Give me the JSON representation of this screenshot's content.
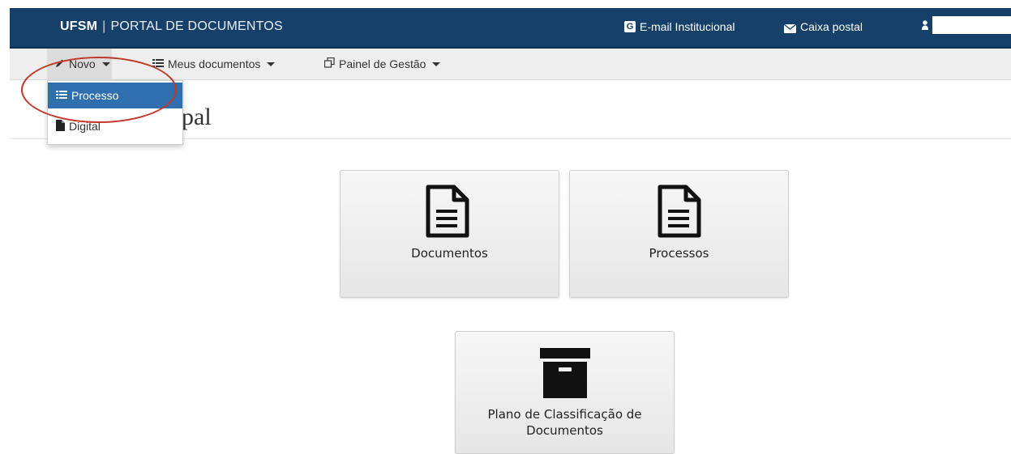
{
  "header": {
    "brand_strong": "UFSM",
    "brand_sep": "|",
    "brand_rest": "PORTAL DE DOCUMENTOS",
    "email_label": "E-mail Institucional",
    "email_icon": "G",
    "mail_label": "Caixa postal"
  },
  "nav": {
    "novo": "Novo",
    "meus_documentos": "Meus documentos",
    "painel": "Painel de Gestão"
  },
  "dropdown": {
    "items": [
      {
        "label": "Processo",
        "icon": "list-icon"
      },
      {
        "label": "Digital",
        "icon": "file-icon"
      }
    ]
  },
  "page": {
    "title_visible": "pal"
  },
  "tiles": [
    {
      "label": "Documentos",
      "icon": "document-icon"
    },
    {
      "label": "Processos",
      "icon": "document-icon"
    },
    {
      "label_line1": "Plano de Classificação de",
      "label_line2": "Documentos",
      "icon": "archive-box-icon"
    }
  ],
  "colors": {
    "header_bg": "#16406a",
    "nav_bg": "#eeeeee",
    "selected_item": "#2f6fae",
    "annotation": "#c0392b"
  }
}
